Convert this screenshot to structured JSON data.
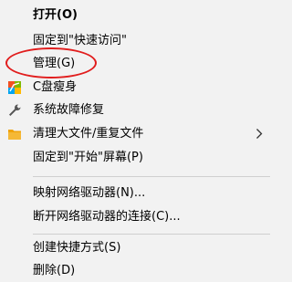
{
  "menu": {
    "items": [
      {
        "label": "打开(O)"
      },
      {
        "label": "固定到\"快速访问\""
      },
      {
        "label": "管理(G)"
      },
      {
        "label": "C盘瘦身",
        "icon": "cleanup-colored-icon"
      },
      {
        "label": "系统故障修复",
        "icon": "wrench-icon"
      },
      {
        "label": "清理大文件/重复文件",
        "icon": "folder-icon"
      },
      {
        "label": "固定到\"开始\"屏幕(P)"
      },
      {
        "label": "映射网络驱动器(N)..."
      },
      {
        "label": "断开网络驱动器的连接(C)..."
      },
      {
        "label": "创建快捷方式(S)"
      },
      {
        "label": "删除(D)"
      }
    ],
    "submenu_arrow_icon": "chevron-right-icon",
    "highlight_color": "#e11d1d"
  }
}
